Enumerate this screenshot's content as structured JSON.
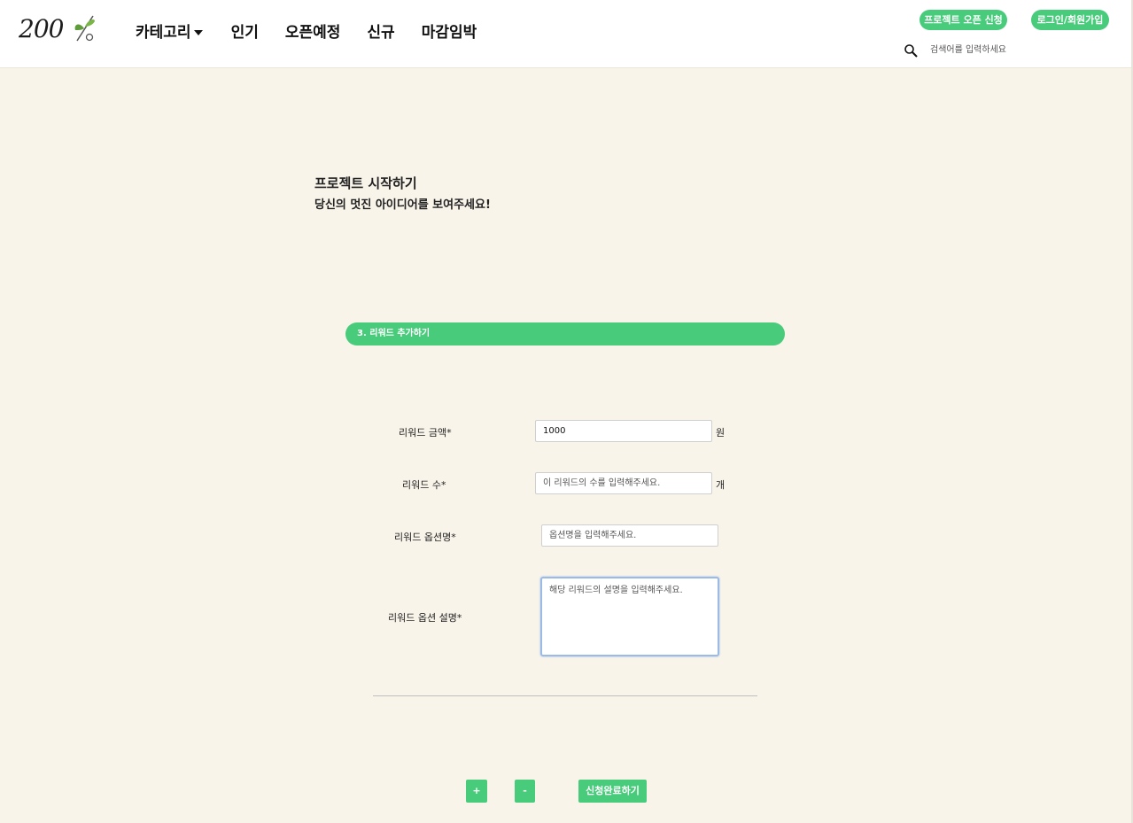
{
  "header": {
    "logo_text": "200",
    "nav": [
      {
        "label": "카테고리"
      },
      {
        "label": "인기"
      },
      {
        "label": "오픈예정"
      },
      {
        "label": "신규"
      },
      {
        "label": "마감임박"
      }
    ],
    "open_project_label": "프로젝트 오픈 신청",
    "login_label": "로그인/회원가입",
    "search_placeholder": "검색어를 입력하세요"
  },
  "page": {
    "title": "프로젝트 시작하기",
    "subtitle": "당신의 멋진 아이디어를 보여주세요!"
  },
  "section": {
    "title": "3. 리워드 추가하기"
  },
  "form": {
    "amount_label": "리워드 금액*",
    "amount_value": "1000",
    "amount_unit": "원",
    "count_label": "리워드 수*",
    "count_placeholder": "이 리워드의 수를 입력해주세요.",
    "count_unit": "개",
    "option_name_label": "리워드 옵션명*",
    "option_name_placeholder": "옵션명을 입력해주세요.",
    "option_desc_label": "리워드 옵션 설명*",
    "option_desc_placeholder": "해당 리워드의 설명을 입력해주세요."
  },
  "actions": {
    "add_label": "+",
    "remove_label": "-",
    "submit_label": "신청완료하기"
  },
  "colors": {
    "accent": "#48cb7b",
    "background": "#f9f4ea"
  }
}
